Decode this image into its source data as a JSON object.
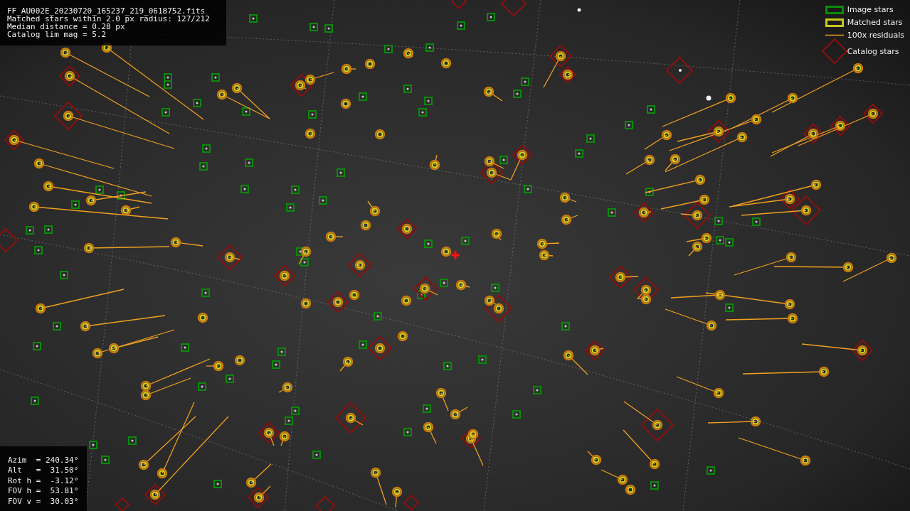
{
  "info_box": {
    "lines": [
      "FF_AU002E_20230720_165237_219_0618752.fits",
      "Matched stars within 2.0 px radius: 127/212",
      "Median distance = 0.28 px",
      "Catalog lim mag = 5.2"
    ]
  },
  "legend": [
    {
      "kind": "image",
      "label": "Image stars"
    },
    {
      "kind": "matched",
      "label": "Matched stars"
    },
    {
      "kind": "residual",
      "label": "100x residuals"
    },
    {
      "kind": "catalog",
      "label": "Catalog stars"
    }
  ],
  "pointing_box": {
    "lines": [
      "Azim  = 240.34°",
      "Alt   =  31.50°",
      "Rot h =  -3.12°",
      "FOV h =  53.81°",
      "FOV v =  30.03°"
    ]
  }
}
